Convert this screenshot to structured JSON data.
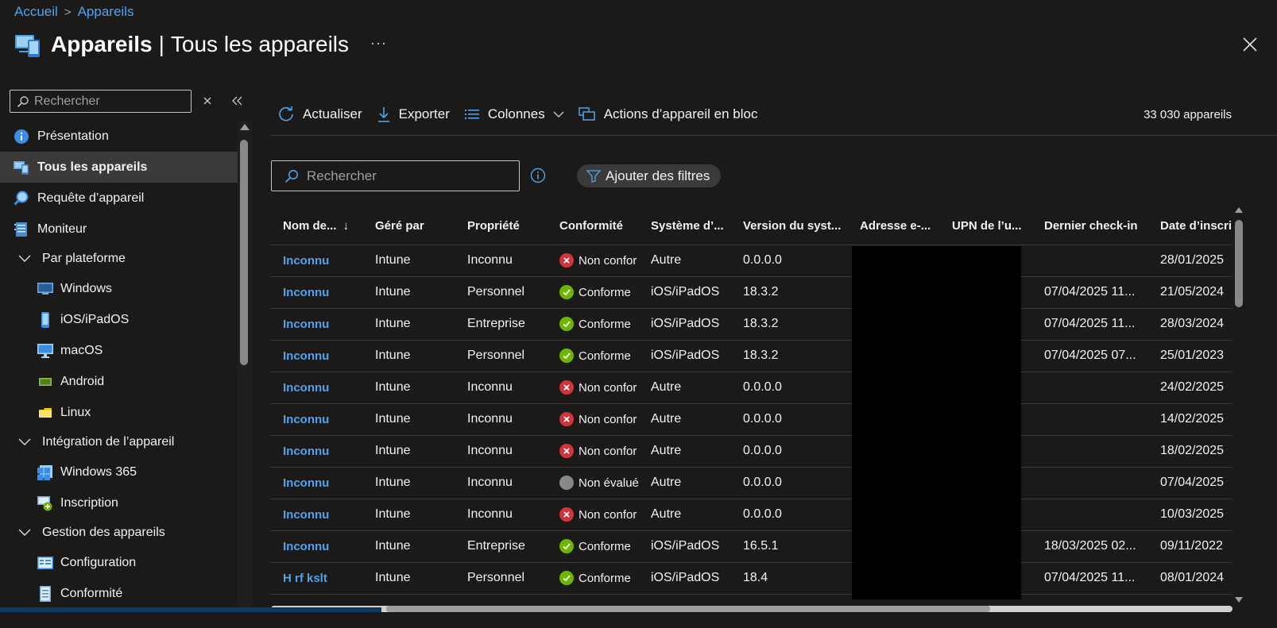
{
  "breadcrumb": {
    "home": "Accueil",
    "current": "Appareils"
  },
  "header": {
    "title_strong": "Appareils",
    "title_sep": "|",
    "title_rest": "Tous les appareils",
    "more": "···"
  },
  "sidebar": {
    "search_placeholder": "Rechercher",
    "items": [
      {
        "label": "Présentation",
        "icon": "info-icon"
      },
      {
        "label": "Tous les appareils",
        "icon": "devices-icon",
        "selected": true
      },
      {
        "label": "Requête d’appareil",
        "icon": "query-icon"
      },
      {
        "label": "Moniteur",
        "icon": "monitor-icon"
      },
      {
        "label": "Par plateforme",
        "icon": "chevron-down-icon",
        "group": true
      },
      {
        "label": "Windows",
        "icon": "windows-icon",
        "sub": true
      },
      {
        "label": "iOS/iPadOS",
        "icon": "ios-icon",
        "sub": true
      },
      {
        "label": "macOS",
        "icon": "macos-icon",
        "sub": true
      },
      {
        "label": "Android",
        "icon": "android-icon",
        "sub": true
      },
      {
        "label": "Linux",
        "icon": "linux-icon",
        "sub": true
      },
      {
        "label": "Intégration de l’appareil",
        "icon": "chevron-down-icon",
        "group": true
      },
      {
        "label": "Windows 365",
        "icon": "windows365-icon",
        "sub": true
      },
      {
        "label": "Inscription",
        "icon": "enrollment-icon",
        "sub": true
      },
      {
        "label": "Gestion des appareils",
        "icon": "chevron-down-icon",
        "group": true
      },
      {
        "label": "Configuration",
        "icon": "configuration-icon",
        "sub": true
      },
      {
        "label": "Conformité",
        "icon": "compliance-icon",
        "sub": true
      }
    ]
  },
  "toolbar": {
    "refresh": "Actualiser",
    "export": "Exporter",
    "columns": "Colonnes",
    "bulk_actions": "Actions d’appareil en bloc",
    "device_count": "33 030 appareils"
  },
  "filters": {
    "search_placeholder": "Rechercher",
    "add_filters": "Ajouter des filtres"
  },
  "table": {
    "columns": [
      "Nom de...",
      "Géré par",
      "Propriété",
      "Conformité",
      "Système d’...",
      "Version du syst...",
      "Adresse e-...",
      "UPN de l’u...",
      "Dernier check-in",
      "Date d’inscri"
    ],
    "rows": [
      {
        "name": "Inconnu",
        "managed_by": "Intune",
        "ownership": "Inconnu",
        "compliance": "Non confor",
        "status": "bad",
        "os": "Autre",
        "os_version": "0.0.0.0",
        "email": "",
        "upn": "",
        "last_checkin": "",
        "enrolled": "28/01/2025"
      },
      {
        "name": "Inconnu",
        "managed_by": "Intune",
        "ownership": "Personnel",
        "compliance": "Conforme",
        "status": "ok",
        "os": "iOS/iPadOS",
        "os_version": "18.3.2",
        "email": "",
        "upn": "",
        "last_checkin": "07/04/2025 11...",
        "enrolled": "21/05/2024"
      },
      {
        "name": "Inconnu",
        "managed_by": "Intune",
        "ownership": "Entreprise",
        "compliance": "Conforme",
        "status": "ok",
        "os": "iOS/iPadOS",
        "os_version": "18.3.2",
        "email": "",
        "upn": "",
        "last_checkin": "07/04/2025 11...",
        "enrolled": "28/03/2024"
      },
      {
        "name": "Inconnu",
        "managed_by": "Intune",
        "ownership": "Personnel",
        "compliance": "Conforme",
        "status": "ok",
        "os": "iOS/iPadOS",
        "os_version": "18.3.2",
        "email": "",
        "upn": "",
        "last_checkin": "07/04/2025 07...",
        "enrolled": "25/01/2023"
      },
      {
        "name": "Inconnu",
        "managed_by": "Intune",
        "ownership": "Inconnu",
        "compliance": "Non confor",
        "status": "bad",
        "os": "Autre",
        "os_version": "0.0.0.0",
        "email": "",
        "upn": "",
        "last_checkin": "",
        "enrolled": "24/02/2025"
      },
      {
        "name": "Inconnu",
        "managed_by": "Intune",
        "ownership": "Inconnu",
        "compliance": "Non confor",
        "status": "bad",
        "os": "Autre",
        "os_version": "0.0.0.0",
        "email": "",
        "upn": "",
        "last_checkin": "",
        "enrolled": "14/02/2025"
      },
      {
        "name": "Inconnu",
        "managed_by": "Intune",
        "ownership": "Inconnu",
        "compliance": "Non confor",
        "status": "bad",
        "os": "Autre",
        "os_version": "0.0.0.0",
        "email": "",
        "upn": "",
        "last_checkin": "",
        "enrolled": "18/02/2025"
      },
      {
        "name": "Inconnu",
        "managed_by": "Intune",
        "ownership": "Inconnu",
        "compliance": "Non évalué",
        "status": "na",
        "os": "Autre",
        "os_version": "0.0.0.0",
        "email": "",
        "upn": "",
        "last_checkin": "",
        "enrolled": "07/04/2025"
      },
      {
        "name": "Inconnu",
        "managed_by": "Intune",
        "ownership": "Inconnu",
        "compliance": "Non confor",
        "status": "bad",
        "os": "Autre",
        "os_version": "0.0.0.0",
        "email": "",
        "upn": "",
        "last_checkin": "",
        "enrolled": "10/03/2025"
      },
      {
        "name": "Inconnu",
        "managed_by": "Intune",
        "ownership": "Entreprise",
        "compliance": "Conforme",
        "status": "ok",
        "os": "iOS/iPadOS",
        "os_version": "16.5.1",
        "email": "",
        "upn": "",
        "last_checkin": "18/03/2025 02...",
        "enrolled": "09/11/2022"
      },
      {
        "name": "H rf kslt",
        "managed_by": "Intune",
        "ownership": "Personnel",
        "compliance": "Conforme",
        "status": "ok",
        "os": "iOS/iPadOS",
        "os_version": "18.4",
        "email": "",
        "upn": "",
        "last_checkin": "07/04/2025 11...",
        "enrolled": "08/01/2024"
      }
    ]
  },
  "colors": {
    "accent": "#4ea3f1",
    "ok": "#6bb700",
    "bad": "#d13438",
    "na": "#8a8886",
    "background": "#1b1a19",
    "selected": "#3b3a39"
  }
}
